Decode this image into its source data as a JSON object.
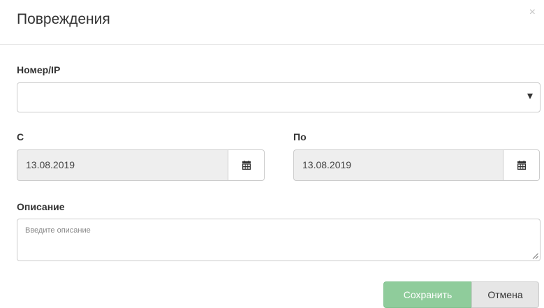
{
  "modal": {
    "title": "Повреждения",
    "close_glyph": "×"
  },
  "form": {
    "number_ip": {
      "label": "Номер/IP",
      "value": ""
    },
    "date_from": {
      "label": "С",
      "value": "13.08.2019",
      "icon": "calendar-icon"
    },
    "date_to": {
      "label": "По",
      "value": "13.08.2019",
      "icon": "calendar-icon"
    },
    "description": {
      "label": "Описание",
      "placeholder": "Введите описание",
      "value": ""
    }
  },
  "buttons": {
    "save_label": "Сохранить",
    "cancel_label": "Отмена"
  },
  "colors": {
    "save_button": "#8fcc9b",
    "cancel_button": "#e6e6e6",
    "readonly_input": "#eeeeee",
    "border": "#cccccc"
  }
}
